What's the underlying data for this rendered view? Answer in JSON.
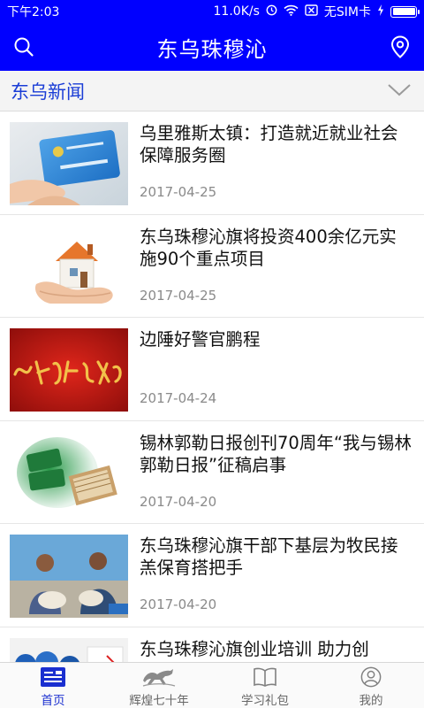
{
  "status_bar": {
    "time": "下午2:03",
    "speed": "11.0K/s",
    "sim": "无SIM卡",
    "battery_level": 1.0
  },
  "app_bar": {
    "title": "东乌珠穆沁",
    "left_icon": "search-icon",
    "right_icon": "location-pin-icon"
  },
  "section": {
    "label": "东乌新闻",
    "toggle_icon": "chevron-down-icon"
  },
  "news": [
    {
      "title": "乌里雅斯太镇：打造就近就业社会保障服务圈",
      "date": "2017-04-25",
      "thumb": "social-security-card-image"
    },
    {
      "title": "东乌珠穆沁旗将投资400余亿元实施90个重点项目",
      "date": "2017-04-25",
      "thumb": "house-in-hands-image"
    },
    {
      "title": "边陲好警官鹏程",
      "date": "2017-04-24",
      "thumb": "red-calligraphy-banner-image"
    },
    {
      "title": "锡林郭勒日报创刊70周年“我与锡林郭勒日报”征稿启事",
      "date": "2017-04-20",
      "thumb": "call-for-papers-image"
    },
    {
      "title": "东乌珠穆沁旗干部下基层为牧民接羔保育搭把手",
      "date": "2017-04-20",
      "thumb": "herders-with-lambs-image"
    },
    {
      "title": "东乌珠穆沁旗创业培训 助力创",
      "date": "",
      "thumb": "training-image"
    }
  ],
  "bottom_nav": [
    {
      "label": "首页",
      "icon": "home-news-icon",
      "active": true
    },
    {
      "label": "辉煌七十年",
      "icon": "galloping-horse-icon",
      "active": false
    },
    {
      "label": "学习礼包",
      "icon": "open-book-icon",
      "active": false
    },
    {
      "label": "我的",
      "icon": "user-profile-icon",
      "active": false
    }
  ],
  "colors": {
    "brand_blue": "#0000ff",
    "section_label": "#1a3dd6",
    "active_tab": "#1a2fd0",
    "date_gray": "#8a8a8a"
  }
}
